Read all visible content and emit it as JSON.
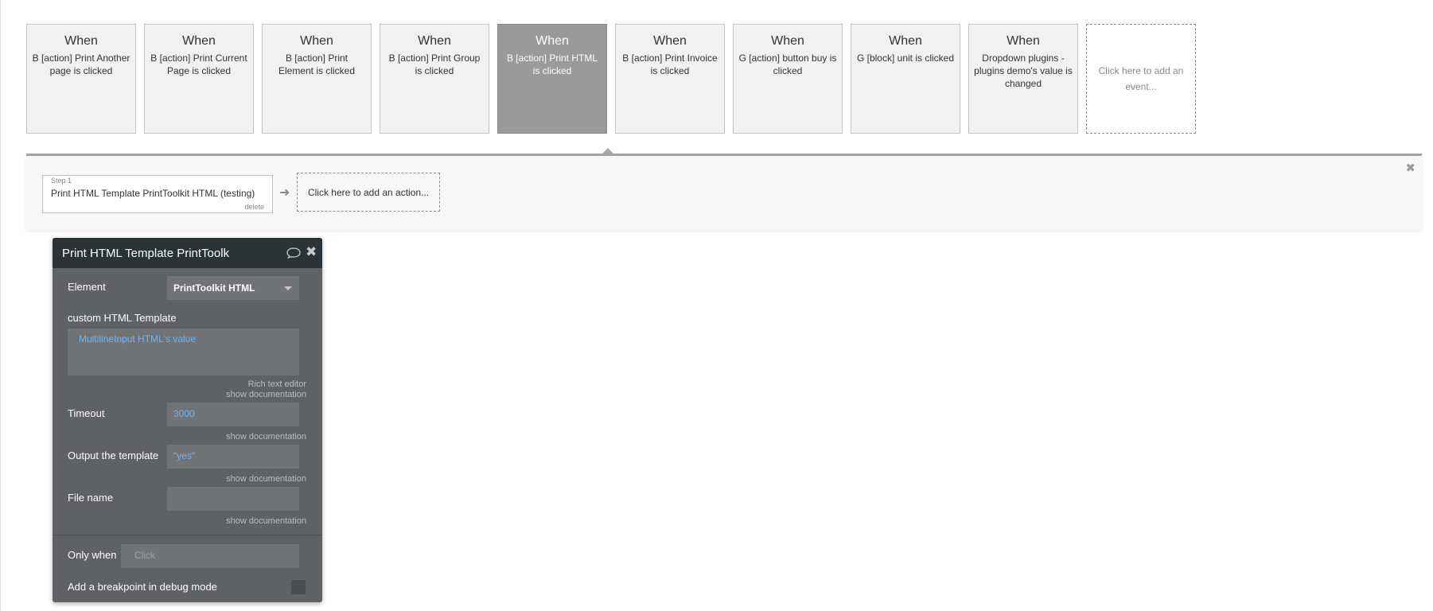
{
  "events": [
    {
      "when": "When",
      "description": "B [action] Print Another page is clicked",
      "selected": false
    },
    {
      "when": "When",
      "description": "B [action] Print Current Page is clicked",
      "selected": false
    },
    {
      "when": "When",
      "description": "B [action] Print Element is clicked",
      "selected": false
    },
    {
      "when": "When",
      "description": "B [action] Print Group is clicked",
      "selected": false
    },
    {
      "when": "When",
      "description": "B [action] Print HTML is clicked",
      "selected": true
    },
    {
      "when": "When",
      "description": "B [action] Print Invoice is clicked",
      "selected": false
    },
    {
      "when": "When",
      "description": "G [action] button buy is clicked",
      "selected": false
    },
    {
      "when": "When",
      "description": "G [block] unit is clicked",
      "selected": false
    },
    {
      "when": "When",
      "description": "Dropdown plugins - plugins demo's value is changed",
      "selected": false
    }
  ],
  "add_event_label": "Click here to add an event...",
  "workflow": {
    "step": {
      "number": "Step 1",
      "title": "Print HTML Template PrintToolkit HTML (testing)",
      "delete_label": "delete"
    },
    "add_action_label": "Click here to add an action..."
  },
  "editor": {
    "title": "Print HTML Template PrintToolk",
    "element_label": "Element",
    "element_value": "PrintToolkit HTML",
    "custom_html_label": "custom HTML Template",
    "custom_html_value": "MultilineInput HTML's value",
    "rich_text_label": "Rich text editor",
    "show_documentation": "show documentation",
    "timeout_label": "Timeout",
    "timeout_value": "3000",
    "output_label": "Output the template",
    "output_value": "\"yes\"",
    "filename_label": "File name",
    "filename_value": "",
    "only_when_label": "Only when",
    "only_when_placeholder": "Click",
    "breakpoint_label": "Add a breakpoint in debug mode"
  },
  "icons": {
    "close": "close-icon",
    "comment": "comment-icon",
    "arrow": "arrow-right-icon",
    "dropdown": "chevron-down-icon"
  },
  "colors": {
    "selected_event": "#999a99",
    "editor_bg": "#5e6264",
    "editor_header": "#2c3337",
    "dynamic_value": "#6cb4f4"
  }
}
